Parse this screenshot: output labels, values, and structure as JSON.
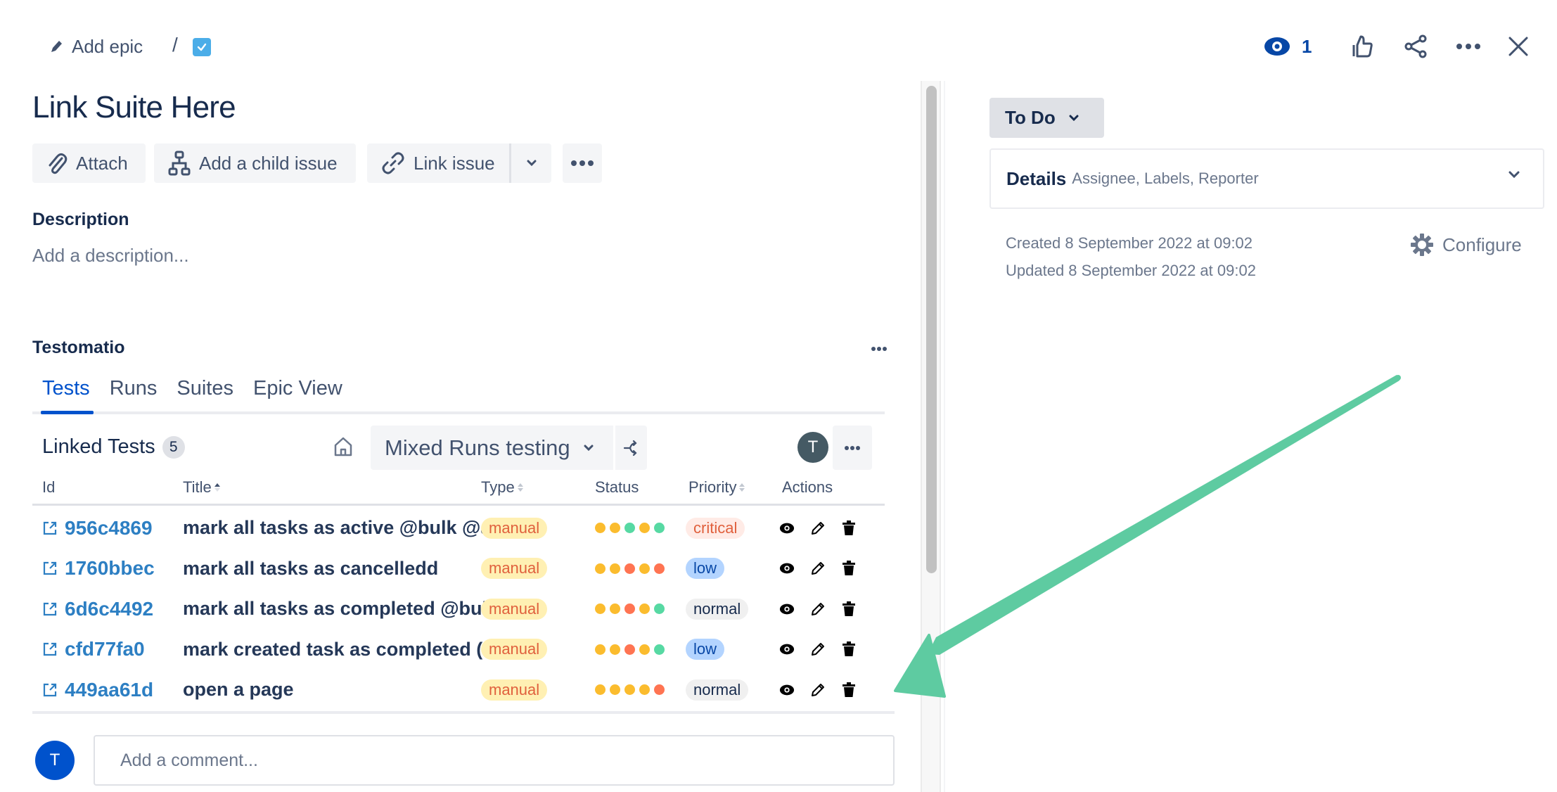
{
  "breadcrumb": {
    "add_epic_label": "Add epic",
    "separator": "/",
    "issue_type_icon": "checkbox-task-icon"
  },
  "header_actions": {
    "watch_count": "1",
    "icons": [
      "eye-icon",
      "thumbs-up-icon",
      "share-icon",
      "more-icon",
      "close-icon"
    ]
  },
  "issue": {
    "title": "Link Suite Here",
    "buttons": {
      "attach": "Attach",
      "add_child": "Add a child issue",
      "link_issue": "Link issue"
    },
    "description_label": "Description",
    "description_placeholder": "Add a description..."
  },
  "testomatio": {
    "section_title": "Testomatio",
    "tabs": [
      {
        "label": "Tests",
        "active": true
      },
      {
        "label": "Runs",
        "active": false
      },
      {
        "label": "Suites",
        "active": false
      },
      {
        "label": "Epic View",
        "active": false
      }
    ],
    "linked_tests_label": "Linked Tests",
    "linked_tests_count": "5",
    "run_selector_value": "Mixed Runs testing",
    "user_initial": "T",
    "columns": {
      "id": "Id",
      "title": "Title",
      "type": "Type",
      "status": "Status",
      "priority": "Priority",
      "actions": "Actions"
    },
    "status_colors": {
      "yellow": "#fbbc2e",
      "green": "#57d9a3",
      "red": "#ff7452"
    },
    "rows": [
      {
        "id": "956c4869",
        "title": "mark all tasks as active @bulk @a",
        "type": "manual",
        "status": [
          "yellow",
          "yellow",
          "green",
          "yellow",
          "green"
        ],
        "priority": "critical"
      },
      {
        "id": "1760bbec",
        "title": "mark all tasks as cancelledd",
        "type": "manual",
        "status": [
          "yellow",
          "yellow",
          "red",
          "yellow",
          "red"
        ],
        "priority": "low"
      },
      {
        "id": "6d6c4492",
        "title": "mark all tasks as completed @bul",
        "type": "manual",
        "status": [
          "yellow",
          "yellow",
          "red",
          "yellow",
          "green"
        ],
        "priority": "normal"
      },
      {
        "id": "cfd77fa0",
        "title": "mark created task as completed (",
        "type": "manual",
        "status": [
          "yellow",
          "yellow",
          "red",
          "yellow",
          "green"
        ],
        "priority": "low"
      },
      {
        "id": "449aa61d",
        "title": "open a page",
        "type": "manual",
        "status": [
          "yellow",
          "yellow",
          "yellow",
          "yellow",
          "red"
        ],
        "priority": "normal"
      }
    ]
  },
  "comment": {
    "avatar_initial": "T",
    "placeholder": "Add a comment..."
  },
  "sidebar": {
    "status": "To Do",
    "details_title": "Details",
    "details_fields": "Assignee, Labels, Reporter",
    "created": "Created 8 September 2022 at 09:02",
    "updated": "Updated 8 September 2022 at 09:02",
    "configure_label": "Configure"
  },
  "annotation": {
    "arrow_color": "#5ecba1"
  }
}
